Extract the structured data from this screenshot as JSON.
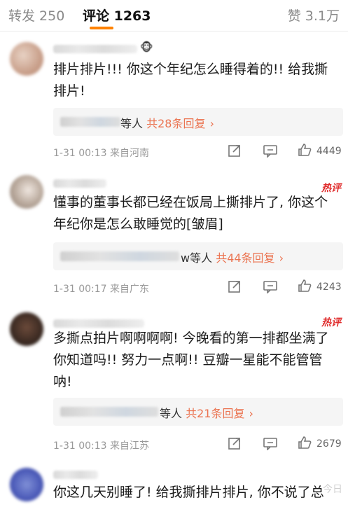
{
  "tabs": {
    "repost": "转发 250",
    "comment": "评论 1263",
    "like": "赞 3.1万"
  },
  "comments": [
    {
      "text_line1": "排片排片!!! 你这个年纪怎么睡得着的!! 给我撕",
      "text_line2": "排片!",
      "reply_suffix": "等人",
      "reply_count": "共28条回复",
      "meta": "1-31 00:13 来自河南",
      "likes": "4449",
      "hot": ""
    },
    {
      "text_line1": "懂事的董事长都已经在饭局上撕排片了, 你这个",
      "text_line2": "年纪你是怎么敢睡觉的[皱眉]",
      "reply_suffix": "w等人",
      "reply_count": "共44条回复",
      "meta": "1-31 00:17 来自广东",
      "likes": "4243",
      "hot": "热评"
    },
    {
      "text_line1": "多撕点拍片啊啊啊啊! 今晚看的第一排都坐满了",
      "text_line2": "你知道吗!! 努力一点啊!! 豆瓣一星能不能管管",
      "text_line3": "呐!",
      "reply_suffix": "等人",
      "reply_count": "共21条回复",
      "meta": "1-31 00:13 来自江苏",
      "likes": "2679",
      "hot": "热评"
    },
    {
      "text_line1": "你这几天别睡了! 给我撕排片排片, 你不说了总"
    }
  ],
  "icons": {
    "share": "share-icon",
    "comment": "comment-icon",
    "like": "thumbs-up-icon"
  },
  "watermark": "今日",
  "colors": {
    "accent": "#ff8200",
    "reply_link": "#eb7350",
    "hot": "#e02f2f"
  }
}
